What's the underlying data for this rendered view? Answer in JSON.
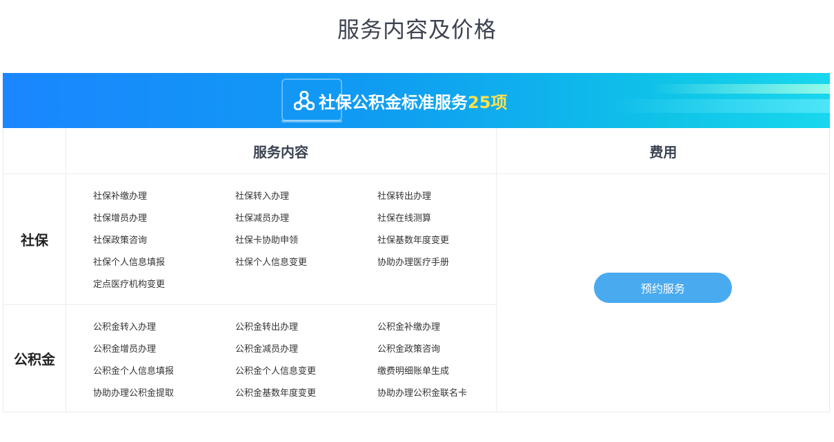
{
  "page_title": "服务内容及价格",
  "banner": {
    "title": "社保公积金标准服务",
    "count": "25项",
    "icon": "share-nodes-icon"
  },
  "table": {
    "headers": {
      "content": "服务内容",
      "fee": "费用"
    },
    "sections": [
      {
        "label": "社保",
        "items": [
          "社保补缴办理",
          "社保转入办理",
          "社保转出办理",
          "社保增员办理",
          "社保减员办理",
          "社保在线测算",
          "社保政策咨询",
          "社保卡协助申领",
          "社保基数年度变更",
          "社保个人信息填报",
          "社保个人信息变更",
          "协助办理医疗手册",
          "定点医疗机构变更"
        ]
      },
      {
        "label": "公积金",
        "items": [
          "公积金转入办理",
          "公积金转出办理",
          "公积金补缴办理",
          "公积金增员办理",
          "公积金减员办理",
          "公积金政策咨询",
          "公积金个人信息填报",
          "公积金个人信息变更",
          "缴费明细账单生成",
          "协助办理公积金提取",
          "公积金基数年度变更",
          "协助办理公积金联名卡"
        ]
      }
    ],
    "book_button": "预约服务"
  },
  "colors": {
    "accent": "#4aaaf0",
    "banner_start": "#1a86ff",
    "banner_end": "#19d7ee",
    "count_highlight": "#ffe14d"
  }
}
